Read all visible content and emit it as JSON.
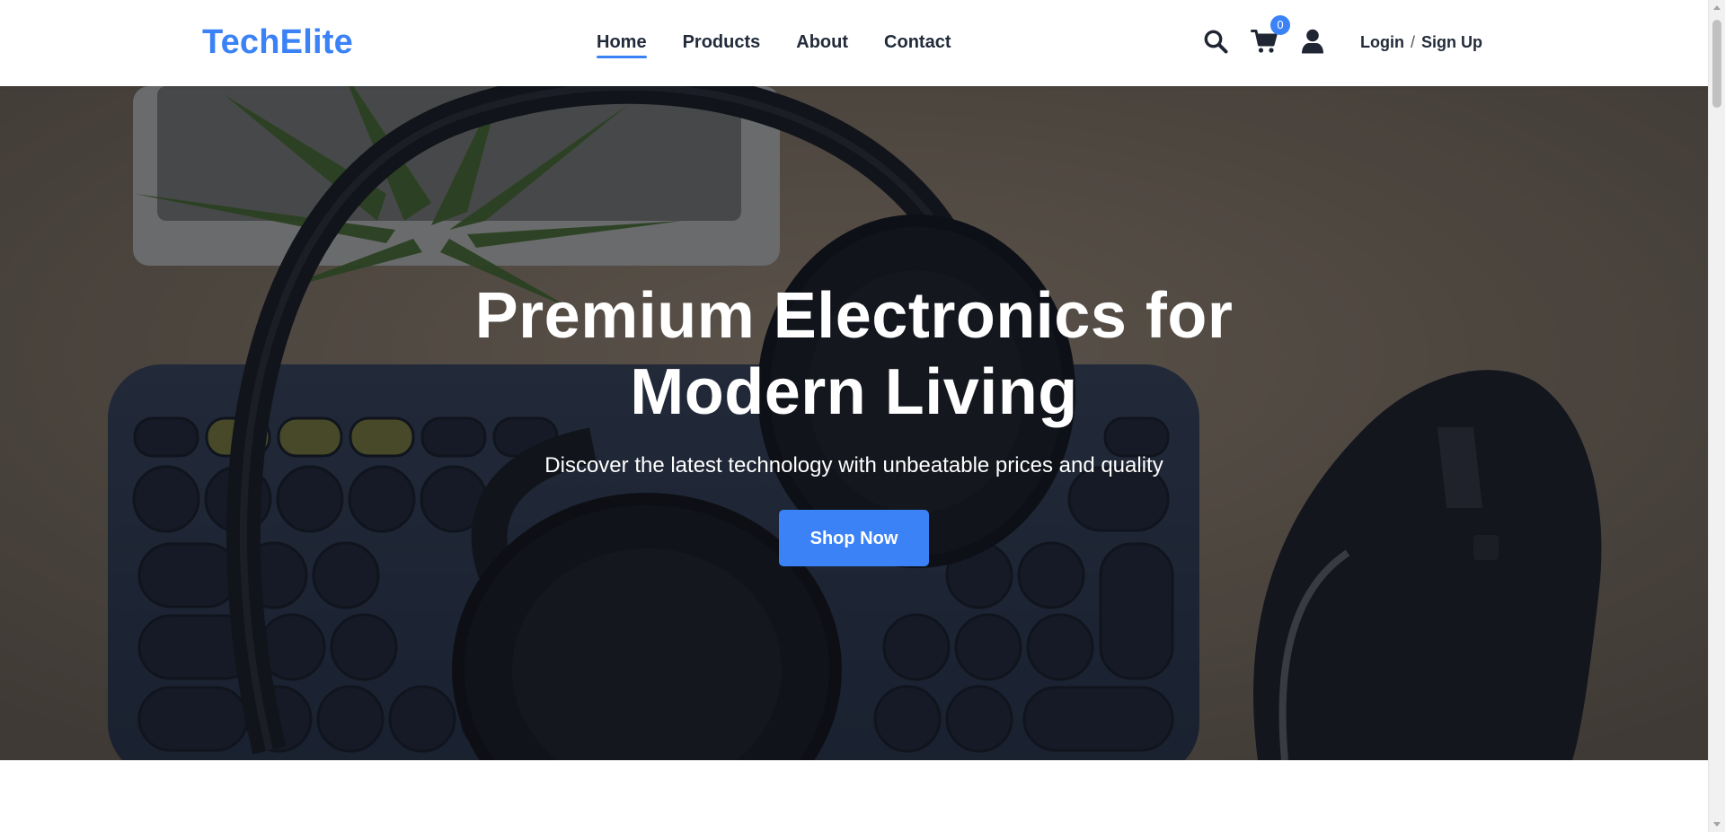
{
  "brand": {
    "name": "TechElite",
    "accent_color": "#3b82f6"
  },
  "nav": {
    "items": [
      {
        "label": "Home",
        "active": true
      },
      {
        "label": "Products",
        "active": false
      },
      {
        "label": "About",
        "active": false
      },
      {
        "label": "Contact",
        "active": false
      }
    ]
  },
  "header_icons": {
    "search_icon": "search-icon",
    "cart_icon": "cart-icon",
    "cart_count": "0",
    "user_icon": "user-icon"
  },
  "auth": {
    "login_label": "Login",
    "separator": "/",
    "signup_label": "Sign Up"
  },
  "hero": {
    "title_line1": "Premium Electronics for",
    "title_line2": "Modern Living",
    "subtitle": "Discover the latest technology with unbeatable prices and quality",
    "cta_label": "Shop Now",
    "background_description_icons": [
      "headphones-image",
      "keyboard-image",
      "mouse-image",
      "plant-image"
    ]
  }
}
